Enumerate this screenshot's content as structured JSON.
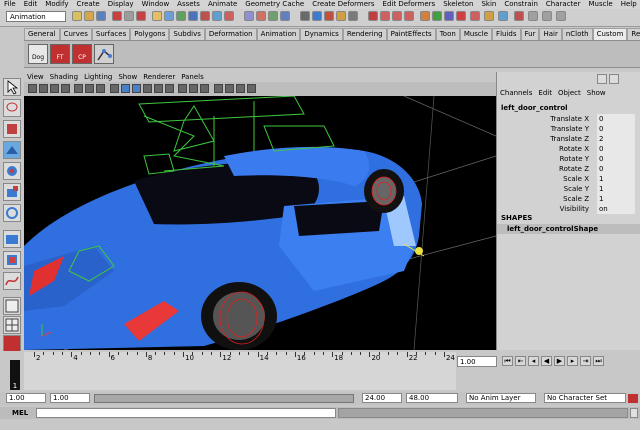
{
  "menubar": [
    "File",
    "Edit",
    "Modify",
    "Create",
    "Display",
    "Window",
    "Assets",
    "Animate",
    "Geometry Cache",
    "Create Deformers",
    "Edit Deformers",
    "Skeleton",
    "Skin",
    "Constrain",
    "Character",
    "Muscle",
    "Help"
  ],
  "status": {
    "mode": "Animation"
  },
  "shelf": {
    "tabs": [
      "General",
      "Curves",
      "Surfaces",
      "Polygons",
      "Subdivs",
      "Deformation",
      "Animation",
      "Dynamics",
      "Rendering",
      "PaintEffects",
      "Toon",
      "Muscle",
      "Fluids",
      "Fur",
      "Hair",
      "nCloth",
      "Custom",
      "RealFlow"
    ],
    "active_tab": "Custom",
    "buttons": [
      "Dog",
      "FT",
      "CP"
    ]
  },
  "viewport": {
    "menus": [
      "View",
      "Shading",
      "Lighting",
      "Show",
      "Renderer",
      "Panels"
    ]
  },
  "channel_box": {
    "menus": [
      "Channels",
      "Edit",
      "Object",
      "Show"
    ],
    "node": "left_door_control",
    "attributes": [
      {
        "name": "Translate X",
        "value": "0"
      },
      {
        "name": "Translate Y",
        "value": "0"
      },
      {
        "name": "Translate Z",
        "value": "2"
      },
      {
        "name": "Rotate X",
        "value": "0"
      },
      {
        "name": "Rotate Y",
        "value": "0"
      },
      {
        "name": "Rotate Z",
        "value": "0"
      },
      {
        "name": "Scale X",
        "value": "1"
      },
      {
        "name": "Scale Y",
        "value": "1"
      },
      {
        "name": "Scale Z",
        "value": "1"
      },
      {
        "name": "Visibility",
        "value": "on"
      }
    ],
    "shapes_header": "SHAPES",
    "shape": "left_door_controlShape"
  },
  "timeline": {
    "ticks": [
      "2",
      "4",
      "6",
      "8",
      "10",
      "12",
      "14",
      "16",
      "18",
      "20",
      "22",
      "24"
    ],
    "current_frame": "1",
    "frame_field": "1.00"
  },
  "range": {
    "start": "1.00",
    "playback_start": "1.00",
    "playback_end": "24.00",
    "end": "48.00",
    "anim_layer": "No Anim Layer",
    "character_set": "No Character Set"
  },
  "command": {
    "label": "MEL"
  }
}
